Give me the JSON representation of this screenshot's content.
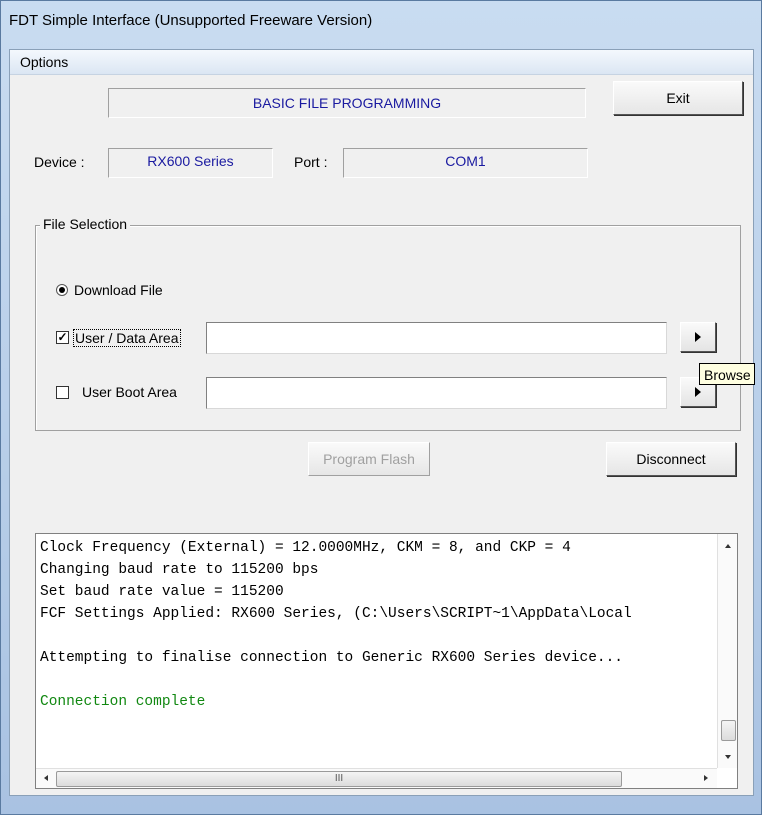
{
  "window": {
    "title": "FDT Simple Interface   (Unsupported Freeware Version)"
  },
  "menu": {
    "options_label": "Options"
  },
  "header": {
    "mode_label": "BASIC FILE PROGRAMMING",
    "exit_label": "Exit"
  },
  "connection": {
    "device_label": "Device :",
    "device_value": "RX600 Series",
    "port_label": "Port :",
    "port_value": "COM1"
  },
  "file_selection": {
    "group_label": "File Selection",
    "download_file_label": "Download File",
    "download_file_selected": true,
    "user_data_area_label": "User / Data Area",
    "user_data_area_checked": true,
    "user_data_area_value": "",
    "user_boot_area_label": "User Boot Area",
    "user_boot_area_checked": false,
    "user_boot_area_value": "",
    "browse_tooltip": "Browse f"
  },
  "actions": {
    "program_flash_label": "Program Flash",
    "disconnect_label": "Disconnect"
  },
  "log": {
    "lines": [
      {
        "text": "Clock Frequency (External) = 12.0000MHz, CKM = 8, and CKP = 4",
        "color": "#000000"
      },
      {
        "text": "Changing baud rate to 115200 bps",
        "color": "#000000"
      },
      {
        "text": "Set baud rate value = 115200",
        "color": "#000000"
      },
      {
        "text": "FCF Settings Applied: RX600 Series, (C:\\Users\\SCRIPT~1\\AppData\\Local",
        "color": "#000000"
      },
      {
        "text": "",
        "color": "#000000"
      },
      {
        "text": "Attempting to finalise connection to Generic RX600 Series device...",
        "color": "#000000"
      },
      {
        "text": "",
        "color": "#000000"
      },
      {
        "text": "Connection complete",
        "color": "#118811"
      }
    ],
    "scrollbar_grip": "III"
  },
  "colors": {
    "device_text": "#1a1aa0",
    "success_text": "#118811",
    "disabled_text": "#a0a0a0"
  }
}
